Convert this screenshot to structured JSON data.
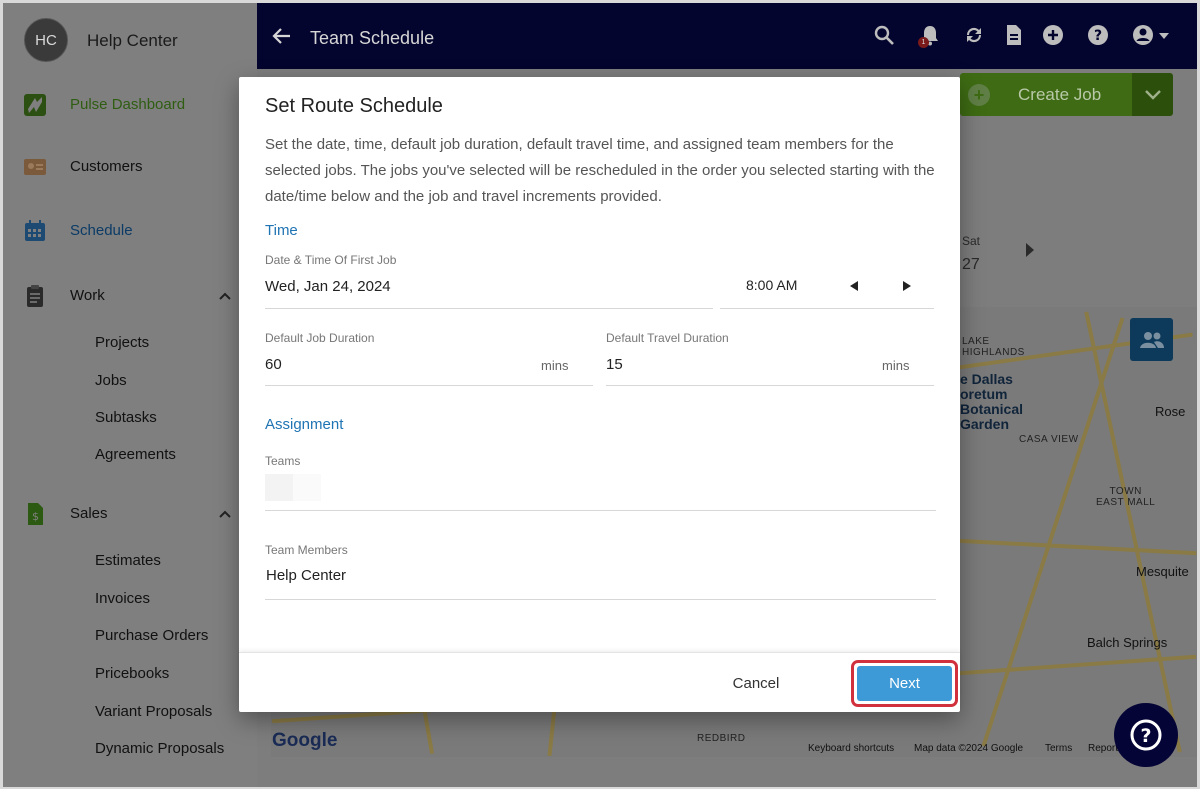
{
  "sidebar": {
    "avatar_initials": "HC",
    "account_name": "Help Center",
    "items": [
      {
        "label": "Pulse Dashboard",
        "icon": "pulse-logo-icon"
      },
      {
        "label": "Customers",
        "icon": "id-card-icon"
      },
      {
        "label": "Schedule",
        "icon": "calendar-icon"
      },
      {
        "label": "Work",
        "icon": "clipboard-icon"
      },
      {
        "label": "Sales",
        "icon": "dollar-document-icon"
      }
    ],
    "work_subitems": [
      "Projects",
      "Jobs",
      "Subtasks",
      "Agreements"
    ],
    "sales_subitems": [
      "Estimates",
      "Invoices",
      "Purchase Orders",
      "Pricebooks",
      "Variant Proposals",
      "Dynamic Proposals"
    ]
  },
  "topbar": {
    "title": "Team Schedule",
    "notification_count": "1",
    "icons": [
      "back-arrow-icon",
      "search-icon",
      "bell-icon",
      "sync-icon",
      "document-icon",
      "plus-circle-icon",
      "help-circle-icon",
      "account-icon"
    ]
  },
  "background": {
    "create_job_label": "Create Job",
    "day_label": "Sat",
    "day_number": "27",
    "map_labels": {
      "highlands": "LAKE\nHIGHLANDS",
      "arboretum": "e Dallas\noretum\nBotanical\nGarden",
      "casa_view": "CASA VIEW",
      "rose": "Rose",
      "town_east": "TOWN\nEAST MALL",
      "mesquite": "Mesquite",
      "balch": "Balch Springs",
      "redbird": "REDBIRD"
    },
    "map_footer": {
      "shortcuts": "Keyboard shortcuts",
      "map_data": "Map data ©2024 Google",
      "terms": "Terms",
      "report": "Report"
    },
    "google_logo": "Google"
  },
  "modal": {
    "title": "Set Route Schedule",
    "description": "Set the date, time, default job duration, default travel time, and assigned team members for the selected jobs. The jobs you've selected will be rescheduled in the order you selected starting with the date/time below and the job and travel increments provided.",
    "time_section": "Time",
    "date_label": "Date & Time Of First Job",
    "date_value": "Wed, Jan 24, 2024",
    "time_value": "8:00 AM",
    "job_duration_label": "Default Job Duration",
    "job_duration_value": "60",
    "job_duration_unit": "mins",
    "travel_duration_label": "Default Travel Duration",
    "travel_duration_value": "15",
    "travel_duration_unit": "mins",
    "assignment_section": "Assignment",
    "teams_label": "Teams",
    "team_members_label": "Team Members",
    "team_members_value": "Help Center",
    "cancel_label": "Cancel",
    "next_label": "Next"
  },
  "colors": {
    "topbar": "#04052e",
    "accent_blue": "#1f74b4",
    "next_button": "#3e9ad6",
    "highlight_ring": "#d1313d",
    "create_job_green": "#3e6b13"
  }
}
